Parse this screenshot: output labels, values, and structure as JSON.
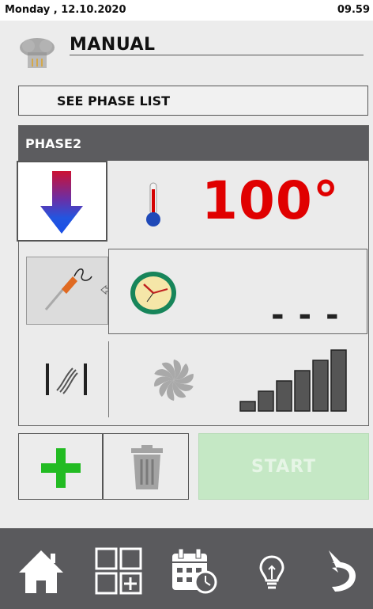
{
  "status": {
    "date": "Monday , 12.10.2020",
    "time": "09.59"
  },
  "header": {
    "title": "MANUAL",
    "icon": "chef-hat-icon"
  },
  "phase_list": {
    "label": "SEE PHASE LIST"
  },
  "phase": {
    "name": "PHASE2",
    "mode_icon": "arrow-down-icon",
    "temperature_icon": "thermometer-icon",
    "temperature": "100°",
    "probe_icon": "core-probe-icon",
    "timer_icon": "clock-icon",
    "timer_value": "- - -",
    "humidity_icon": "humidity-valve-icon",
    "fan_icon": "fan-icon",
    "fan_speed_level": 6,
    "fan_speed_max": 6
  },
  "actions": {
    "add_icon": "plus-icon",
    "delete_icon": "trash-icon",
    "start_label": "START"
  },
  "nav": [
    "home-icon",
    "add-program-icon",
    "calendar-clock-icon",
    "lightbulb-icon",
    "back-icon"
  ],
  "colors": {
    "temperature": "#e00000",
    "header": "#5c5c5f",
    "start_disabled": "#c5e8c5",
    "add": "#22bb22"
  }
}
